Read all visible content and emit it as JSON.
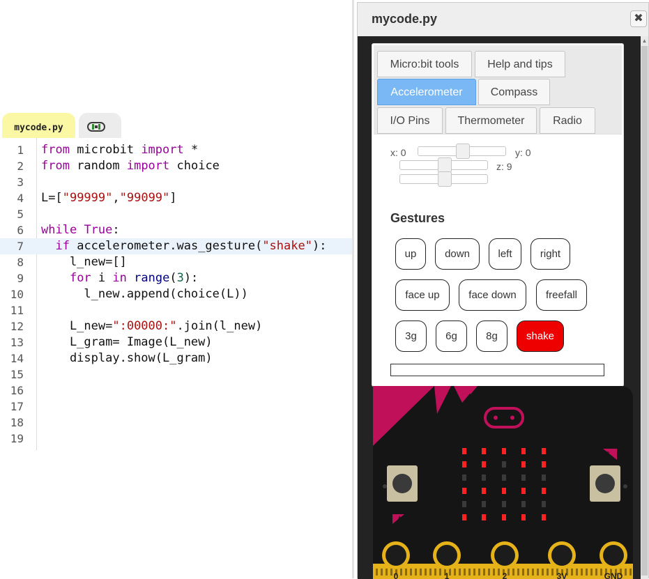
{
  "editor": {
    "active_tab": "mycode.py",
    "lines": [
      {
        "n": "1",
        "tokens": [
          {
            "t": "from",
            "c": "kw"
          },
          {
            "t": " microbit ",
            "c": ""
          },
          {
            "t": "import",
            "c": "kw"
          },
          {
            "t": " *",
            "c": ""
          }
        ]
      },
      {
        "n": "2",
        "tokens": [
          {
            "t": "from",
            "c": "kw"
          },
          {
            "t": " random ",
            "c": ""
          },
          {
            "t": "import",
            "c": "kw"
          },
          {
            "t": " choice",
            "c": ""
          }
        ]
      },
      {
        "n": "3",
        "tokens": []
      },
      {
        "n": "4",
        "tokens": [
          {
            "t": "L=[",
            "c": ""
          },
          {
            "t": "\"99999\"",
            "c": "str"
          },
          {
            "t": ",",
            "c": ""
          },
          {
            "t": "\"99099\"",
            "c": "str"
          },
          {
            "t": "]",
            "c": ""
          }
        ]
      },
      {
        "n": "5",
        "tokens": []
      },
      {
        "n": "6",
        "tokens": [
          {
            "t": "while",
            "c": "kw"
          },
          {
            "t": " ",
            "c": ""
          },
          {
            "t": "True",
            "c": "kw"
          },
          {
            "t": ":",
            "c": ""
          }
        ]
      },
      {
        "n": "7",
        "tokens": [
          {
            "t": "  ",
            "c": ""
          },
          {
            "t": "if",
            "c": "kw"
          },
          {
            "t": " accelerometer.was_gesture(",
            "c": ""
          },
          {
            "t": "\"shake\"",
            "c": "str"
          },
          {
            "t": "):",
            "c": ""
          }
        ],
        "highlight": true
      },
      {
        "n": "8",
        "tokens": [
          {
            "t": "    l_new=[]",
            "c": ""
          }
        ]
      },
      {
        "n": "9",
        "tokens": [
          {
            "t": "    ",
            "c": ""
          },
          {
            "t": "for",
            "c": "kw"
          },
          {
            "t": " i ",
            "c": ""
          },
          {
            "t": "in",
            "c": "kw"
          },
          {
            "t": " ",
            "c": ""
          },
          {
            "t": "range",
            "c": "kb"
          },
          {
            "t": "(",
            "c": ""
          },
          {
            "t": "3",
            "c": "num"
          },
          {
            "t": "):",
            "c": ""
          }
        ]
      },
      {
        "n": "10",
        "tokens": [
          {
            "t": "      l_new.append(choice(L))",
            "c": ""
          }
        ]
      },
      {
        "n": "11",
        "tokens": []
      },
      {
        "n": "12",
        "tokens": [
          {
            "t": "    L_new=",
            "c": ""
          },
          {
            "t": "\":00000:\"",
            "c": "str"
          },
          {
            "t": ".join(l_new)",
            "c": ""
          }
        ]
      },
      {
        "n": "13",
        "tokens": [
          {
            "t": "    L_gram= Image(L_new)",
            "c": ""
          }
        ]
      },
      {
        "n": "14",
        "tokens": [
          {
            "t": "    display.show(L_gram)",
            "c": ""
          }
        ]
      },
      {
        "n": "15",
        "tokens": []
      },
      {
        "n": "16",
        "tokens": []
      },
      {
        "n": "17",
        "tokens": []
      },
      {
        "n": "18",
        "tokens": []
      },
      {
        "n": "19",
        "tokens": []
      }
    ]
  },
  "panel": {
    "title": "mycode.py",
    "close_symbol": "✖",
    "tabs": [
      {
        "label": "Micro:bit tools",
        "active": false
      },
      {
        "label": "Help and tips",
        "active": false
      },
      {
        "label": "Accelerometer",
        "active": true
      },
      {
        "label": "Compass",
        "active": false
      },
      {
        "label": "I/O Pins",
        "active": false
      },
      {
        "label": "Thermometer",
        "active": false
      },
      {
        "label": "Radio",
        "active": false
      }
    ],
    "accelerometer": {
      "x_label": "x: 0",
      "y_label": "y: 0",
      "z_label": "z: 9",
      "x_value": 0,
      "y_value": 0,
      "z_value": 9
    },
    "gestures_title": "Gestures",
    "gestures": [
      {
        "label": "up",
        "active": false
      },
      {
        "label": "down",
        "active": false
      },
      {
        "label": "left",
        "active": false
      },
      {
        "label": "right",
        "active": false
      },
      {
        "label": "face up",
        "active": false
      },
      {
        "label": "face down",
        "active": false
      },
      {
        "label": "freefall",
        "active": false
      },
      {
        "label": "3g",
        "active": false
      },
      {
        "label": "6g",
        "active": false
      },
      {
        "label": "8g",
        "active": false
      },
      {
        "label": "shake",
        "active": true
      }
    ]
  },
  "board": {
    "led_grid": [
      [
        1,
        1,
        1,
        1,
        1
      ],
      [
        1,
        1,
        0,
        1,
        1
      ],
      [
        0,
        0,
        0,
        0,
        0
      ],
      [
        1,
        1,
        1,
        1,
        1
      ],
      [
        0,
        0,
        0,
        0,
        0
      ],
      [
        1,
        1,
        1,
        1,
        1
      ]
    ],
    "button_a": "A",
    "button_b": "B",
    "pins": [
      "0",
      "1",
      "2",
      "3V",
      "GND"
    ],
    "colors": {
      "pcb": "#151515",
      "accent": "#c0105a",
      "led_on": "#ff2222",
      "led_off": "#3a3a3a",
      "gold": "#e5b21a"
    }
  }
}
